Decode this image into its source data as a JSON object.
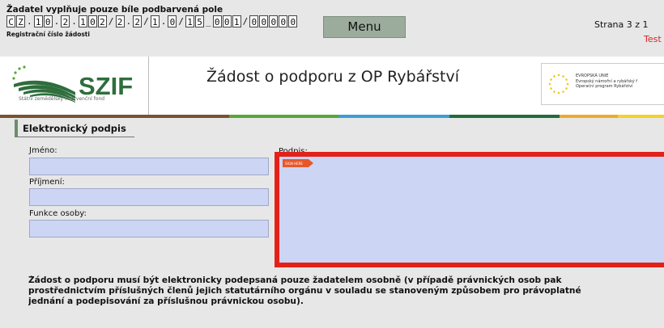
{
  "form_header": {
    "instruction": "Žadatel vyplňuje pouze bíle podbarvená pole",
    "registration_chars": [
      "C",
      "Z",
      ".",
      "1",
      "0",
      ".",
      "2",
      ".",
      "1",
      "0",
      "2",
      "/",
      "2",
      ".",
      "2",
      "/",
      "1",
      ".",
      "0",
      "/",
      "1",
      "5",
      "_",
      "0",
      "0",
      "1",
      "/",
      "0",
      "0",
      "0",
      "0",
      "0"
    ],
    "registration_label": "Registrační číslo žádosti",
    "menu_label": "Menu",
    "page_info": "Strana 3 z 1",
    "test_label": "Test"
  },
  "branding": {
    "szif_logo_text": "SZIF",
    "szif_caption": "Státní zemědělský intervenční fond",
    "app_title": "Žádost o podporu z OP Rybářství",
    "eu_lines": [
      "EVROPSKÁ UNIE",
      "Evropský námořní a rybářský f",
      "Operační program Rybářství"
    ]
  },
  "color_bar": [
    "#7a5230",
    "#59a634",
    "#3c9ed8",
    "#1f6e3a",
    "#f0a82c",
    "#f3d229"
  ],
  "signature_section": {
    "title": "Elektronický podpis",
    "first_name_label": "Jméno:",
    "first_name_value": "",
    "last_name_label": "Příjmení:",
    "last_name_value": "",
    "role_label": "Funkce osoby:",
    "role_value": "",
    "signature_label": "Podpis:",
    "signature_flag_text": "SIGN HERE",
    "notice_lines": [
      "Žádost o podporu musí být elektronicky podepsaná pouze žadatelem osobně (v případě právnických osob pak",
      "prostřednictvím příslušných členů jejich statutárního orgánu v souladu se stanoveným způsobem pro právoplatné",
      "jednání a podepisování za příslušnou právnickou osobu)."
    ]
  }
}
